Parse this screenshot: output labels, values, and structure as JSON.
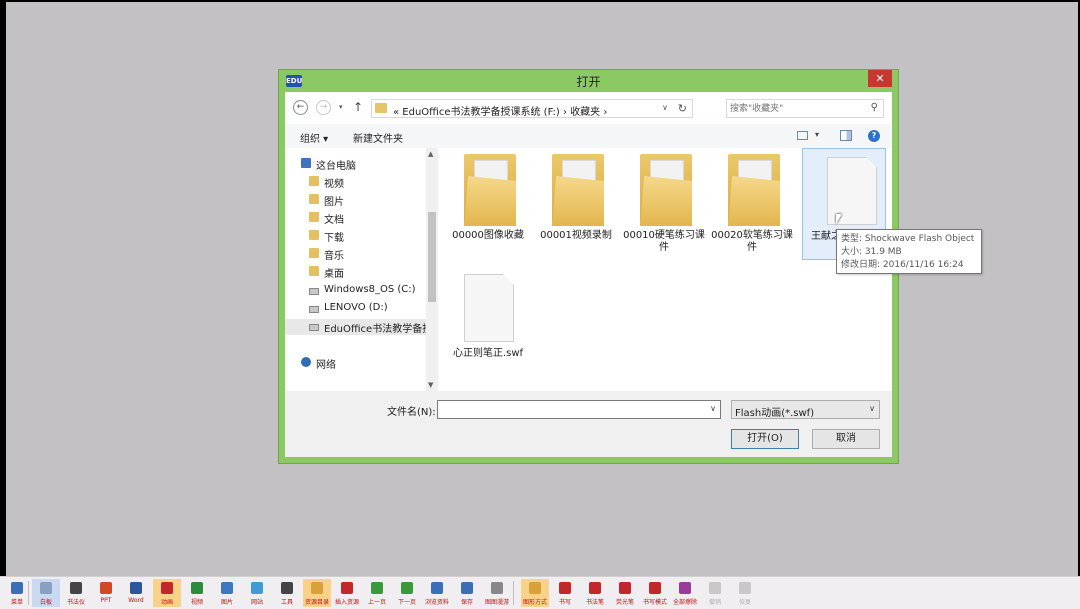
{
  "dialog": {
    "title": "打开",
    "app_icon": "EDU",
    "close_glyph": "✕"
  },
  "nav": {
    "back_glyph": "←",
    "forward_glyph": "→",
    "recent_glyph": "▾",
    "up_glyph": "↑",
    "address_path": "«  EduOffice书法教学备授课系统 (F:)  ›  收藏夹  ›",
    "address_drop_glyph": "∨",
    "refresh_glyph": "↻",
    "search_placeholder": "搜索\"收藏夹\"",
    "search_glyph": "⚲"
  },
  "toolbar": {
    "organize_label": "组织 ▾",
    "new_folder_label": "新建文件夹",
    "view_drop_glyph": "▾",
    "help_glyph": "?"
  },
  "tree": [
    {
      "label": "这台电脑",
      "icon": "pc"
    },
    {
      "label": "视频",
      "icon": "folder"
    },
    {
      "label": "图片",
      "icon": "folder"
    },
    {
      "label": "文档",
      "icon": "folder"
    },
    {
      "label": "下载",
      "icon": "folder"
    },
    {
      "label": "音乐",
      "icon": "folder"
    },
    {
      "label": "桌面",
      "icon": "folder"
    },
    {
      "label": "Windows8_OS (C:)",
      "icon": "win-drive"
    },
    {
      "label": "LENOVO (D:)",
      "icon": "drive"
    },
    {
      "label": "EduOffice书法教学备授",
      "icon": "drive",
      "selected": true
    },
    {
      "label": "网络",
      "icon": "network"
    }
  ],
  "files": [
    {
      "name": "00000图像收藏",
      "type": "folder"
    },
    {
      "name": "00001视频录制",
      "type": "folder"
    },
    {
      "name": "00010硬笔练习课件",
      "type": "folder"
    },
    {
      "name": "00020软笔练习课件",
      "type": "folder"
    },
    {
      "name": "王献之",
      "type": "file",
      "selected": true
    },
    {
      "name": "心正则笔正.swf",
      "type": "file"
    }
  ],
  "tooltip": {
    "type_line": "类型: Shockwave Flash Object",
    "size_line": "大小: 31.9 MB",
    "date_line": "修改日期: 2016/11/16 16:24"
  },
  "bottom": {
    "filename_label": "文件名(N):",
    "filename_value": "",
    "filter_label": "Flash动画(*.swf)",
    "drop_glyph": "∨",
    "open_label": "打开(O)",
    "cancel_label": "取消"
  },
  "scroll": {
    "up_glyph": "▲",
    "down_glyph": "▼"
  },
  "taskbar": [
    {
      "label": "菜单",
      "color": "#3a6fb7"
    },
    {
      "label": "白板",
      "color": "#8aa0c0",
      "state": "hl"
    },
    {
      "label": "书法仪",
      "color": "#444444"
    },
    {
      "label": "PPT",
      "color": "#d24726"
    },
    {
      "label": "Word",
      "color": "#2b579a"
    },
    {
      "label": "动画",
      "color": "#c0282c",
      "state": "active"
    },
    {
      "label": "视频",
      "color": "#2a8c3c"
    },
    {
      "label": "图片",
      "color": "#3b78c0"
    },
    {
      "label": "网站",
      "color": "#3f9ad6"
    },
    {
      "label": "工具",
      "color": "#444444"
    },
    {
      "label": "资源目录",
      "color": "#d8a23a",
      "state": "active"
    },
    {
      "label": "插入资源",
      "color": "#c0282c"
    },
    {
      "label": "上一页",
      "color": "#3a9a3a"
    },
    {
      "label": "下一页",
      "color": "#3a9a3a"
    },
    {
      "label": "浏览资料",
      "color": "#3a6fb7"
    },
    {
      "label": "保存",
      "color": "#3a6fb7"
    },
    {
      "label": "图图漫游",
      "color": "#888888"
    },
    {
      "label": "图形方式",
      "color": "#d8a23a",
      "state": "active"
    },
    {
      "label": "书写",
      "color": "#c0282c"
    },
    {
      "label": "书法笔",
      "color": "#c0282c"
    },
    {
      "label": "荧光笔",
      "color": "#c0282c"
    },
    {
      "label": "书写模式",
      "color": "#c0282c"
    },
    {
      "label": "全部擦除",
      "color": "#9a3a9a"
    },
    {
      "label": "撤销",
      "color": "#c8c8c8",
      "state": "gray"
    },
    {
      "label": "恢复",
      "color": "#c8c8c8",
      "state": "gray"
    }
  ]
}
